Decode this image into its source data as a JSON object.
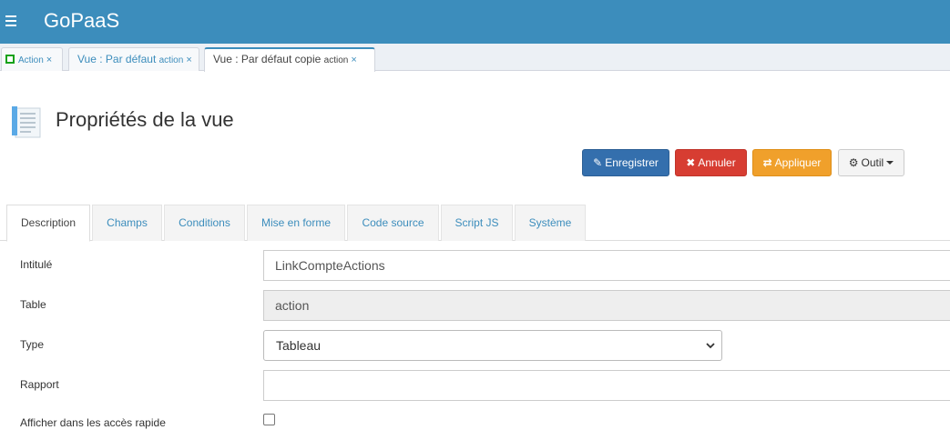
{
  "app": {
    "brand": "GoPaaS"
  },
  "doc_tabs": [
    {
      "label": "Action",
      "close": "×"
    },
    {
      "label": "Vue : Par défaut",
      "sub": "action",
      "close": "×"
    },
    {
      "label": "Vue : Par défaut copie",
      "sub": "action",
      "close": "×",
      "active": true
    }
  ],
  "page": {
    "title": "Propriétés de la vue"
  },
  "toolbar": {
    "save_label": "Enregistrer",
    "cancel_label": "Annuler",
    "apply_label": "Appliquer",
    "tool_label": "Outil"
  },
  "form_tabs": [
    {
      "label": "Description",
      "active": true
    },
    {
      "label": "Champs"
    },
    {
      "label": "Conditions"
    },
    {
      "label": "Mise en forme"
    },
    {
      "label": "Code source"
    },
    {
      "label": "Script JS"
    },
    {
      "label": "Système"
    }
  ],
  "form": {
    "intitule": {
      "label": "Intitulé",
      "value": "LinkCompteActions"
    },
    "table": {
      "label": "Table",
      "value": "action"
    },
    "type": {
      "label": "Type",
      "value": "Tableau"
    },
    "rapport": {
      "label": "Rapport",
      "value": ""
    },
    "acces_rapide": {
      "label": "Afficher dans les accès rapide",
      "checked": false
    }
  },
  "colors": {
    "topbar": "#3c8dbc",
    "save": "#346fad",
    "cancel": "#d73d32",
    "apply": "#f0a02b"
  },
  "icons": {
    "menu": "hamburger-icon",
    "action_tab": "green-square-icon",
    "page": "document-list-icon",
    "save": "save-edit-icon",
    "cancel": "x-icon",
    "apply": "apply-icon",
    "tool": "gear-icon"
  }
}
